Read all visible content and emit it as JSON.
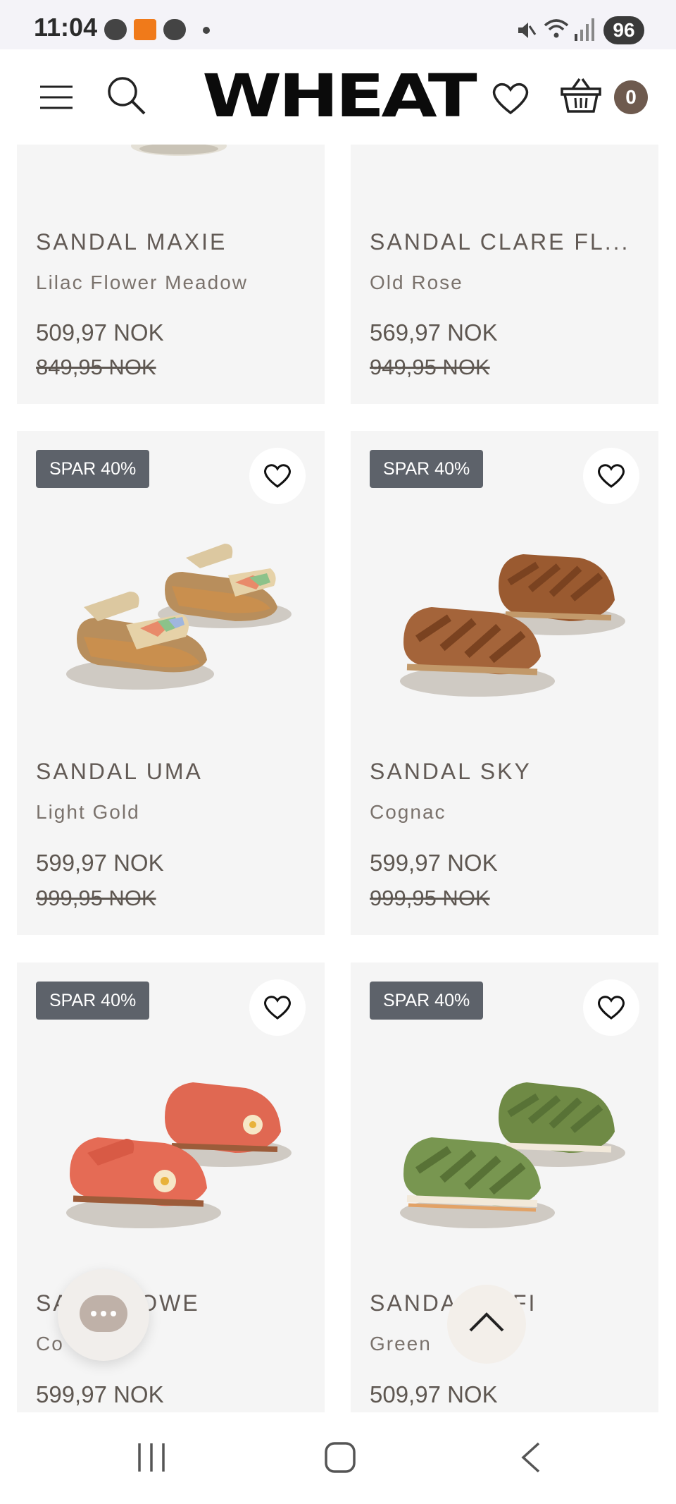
{
  "status_bar": {
    "time": "11:04",
    "battery": "96"
  },
  "header": {
    "logo_text": "WHEAT",
    "cart_count": "0"
  },
  "products": [
    {
      "name": "SANDAL MAXIE",
      "color": "Lilac Flower Meadow",
      "price": "509,97 NOK",
      "old_price": "849,95 NOK"
    },
    {
      "name": "SANDAL CLARE FL...",
      "color": "Old Rose",
      "price": "569,97 NOK",
      "old_price": "949,95 NOK"
    },
    {
      "badge": "SPAR 40%",
      "name": "SANDAL UMA",
      "color": "Light Gold",
      "price": "599,97 NOK",
      "old_price": "999,95 NOK"
    },
    {
      "badge": "SPAR 40%",
      "name": "SANDAL SKY",
      "color": "Cognac",
      "price": "599,97 NOK",
      "old_price": "999,95 NOK"
    },
    {
      "badge": "SPAR 40%",
      "name": "SA        LOWE",
      "color": "Co",
      "price": "599,97 NOK"
    },
    {
      "badge": "SPAR 40%",
      "name": "SANDA        FI",
      "color": "Green",
      "price": "509,97 NOK"
    }
  ],
  "colors": {
    "badge_bg": "#5d626a",
    "card_bg": "#f5f5f5",
    "cart_badge": "#6e5a4e",
    "text": "#5e5751"
  },
  "icons": [
    "menu-icon",
    "search-icon",
    "heart-icon",
    "basket-icon",
    "chat-icon",
    "chevron-up-icon",
    "recent-apps-icon",
    "home-icon",
    "back-icon"
  ]
}
